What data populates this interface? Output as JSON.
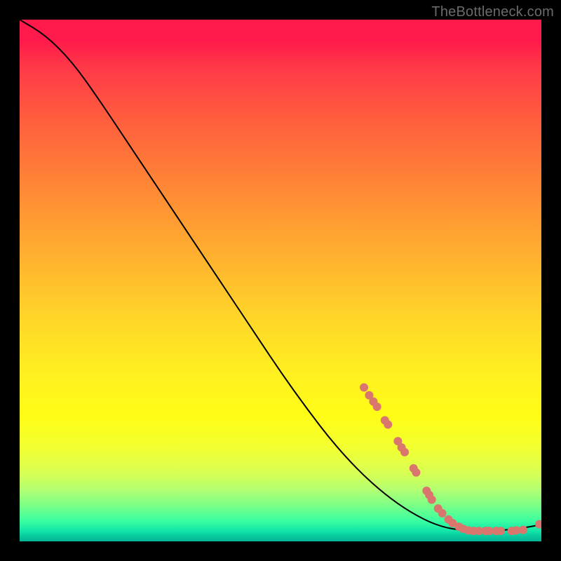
{
  "watermark": "TheBottleneck.com",
  "chart_data": {
    "type": "line",
    "title": "",
    "xlabel": "",
    "ylabel": "",
    "xlim": [
      0,
      100
    ],
    "ylim": [
      0,
      100
    ],
    "series": [
      {
        "name": "curve",
        "style": "line",
        "color": "#000000",
        "points": [
          {
            "x": 0,
            "y": 100
          },
          {
            "x": 5,
            "y": 97
          },
          {
            "x": 10,
            "y": 92
          },
          {
            "x": 15,
            "y": 85
          },
          {
            "x": 20,
            "y": 77.5
          },
          {
            "x": 25,
            "y": 70
          },
          {
            "x": 30,
            "y": 62.5
          },
          {
            "x": 35,
            "y": 55
          },
          {
            "x": 40,
            "y": 47.5
          },
          {
            "x": 45,
            "y": 40
          },
          {
            "x": 50,
            "y": 32.5
          },
          {
            "x": 55,
            "y": 25.5
          },
          {
            "x": 60,
            "y": 19
          },
          {
            "x": 65,
            "y": 13.5
          },
          {
            "x": 70,
            "y": 9
          },
          {
            "x": 75,
            "y": 5.5
          },
          {
            "x": 80,
            "y": 3
          },
          {
            "x": 85,
            "y": 2
          },
          {
            "x": 90,
            "y": 2
          },
          {
            "x": 95,
            "y": 2.3
          },
          {
            "x": 100,
            "y": 3.2
          }
        ]
      },
      {
        "name": "markers",
        "style": "scatter",
        "color": "#d9766e",
        "points": [
          {
            "x": 66,
            "y": 29.5
          },
          {
            "x": 67,
            "y": 28
          },
          {
            "x": 67.8,
            "y": 26.8
          },
          {
            "x": 68.5,
            "y": 25.8
          },
          {
            "x": 70,
            "y": 23.2
          },
          {
            "x": 70.6,
            "y": 22.4
          },
          {
            "x": 72.5,
            "y": 19.2
          },
          {
            "x": 73.2,
            "y": 18
          },
          {
            "x": 73.8,
            "y": 17.1
          },
          {
            "x": 75.5,
            "y": 14
          },
          {
            "x": 76,
            "y": 13.2
          },
          {
            "x": 78,
            "y": 9.7
          },
          {
            "x": 78.5,
            "y": 8.9
          },
          {
            "x": 79,
            "y": 8
          },
          {
            "x": 80.2,
            "y": 6.3
          },
          {
            "x": 81,
            "y": 5.4
          },
          {
            "x": 82.2,
            "y": 4.2
          },
          {
            "x": 83,
            "y": 3.5
          },
          {
            "x": 84.2,
            "y": 2.8
          },
          {
            "x": 85,
            "y": 2.4
          },
          {
            "x": 86,
            "y": 2.1
          },
          {
            "x": 87,
            "y": 2
          },
          {
            "x": 88,
            "y": 2
          },
          {
            "x": 89.3,
            "y": 2
          },
          {
            "x": 90,
            "y": 2
          },
          {
            "x": 91.3,
            "y": 2
          },
          {
            "x": 92.2,
            "y": 2
          },
          {
            "x": 94.3,
            "y": 2
          },
          {
            "x": 95.2,
            "y": 2.1
          },
          {
            "x": 96.5,
            "y": 2.2
          },
          {
            "x": 99.6,
            "y": 3.3
          }
        ]
      }
    ],
    "colors": {
      "gradient_top": "#ff1a4b",
      "gradient_mid": "#ffe028",
      "gradient_bottom": "#08c99f",
      "line": "#000000",
      "marker": "#d9766e"
    }
  }
}
